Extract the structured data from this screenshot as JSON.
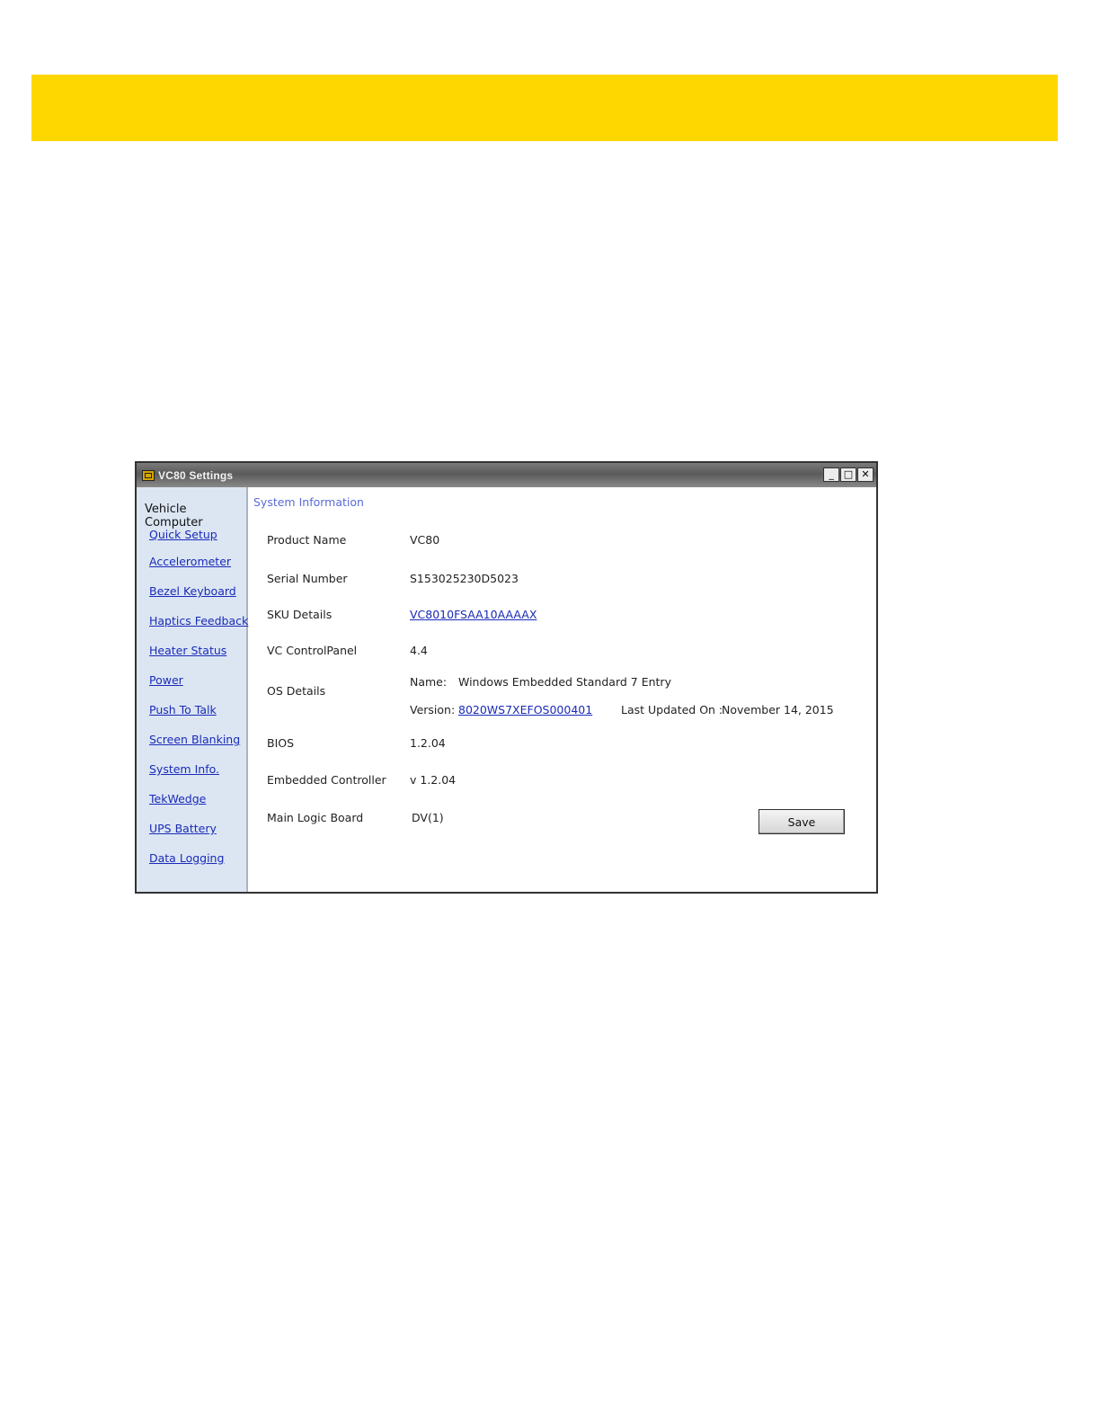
{
  "colors": {
    "banner": "#ffd700",
    "link": "#1a2bb8",
    "section_title": "#5a6bd6",
    "sidebar_bg": "#dce6f3"
  },
  "window": {
    "title": "VC80 Settings",
    "controls": {
      "minimize": "_",
      "maximize": "□",
      "close": "✕"
    }
  },
  "sidebar": {
    "header": "Vehicle Computer",
    "items": [
      {
        "label": "Quick Setup"
      },
      {
        "label": "Accelerometer"
      },
      {
        "label": "Bezel Keyboard"
      },
      {
        "label": "Haptics Feedback"
      },
      {
        "label": "Heater Status"
      },
      {
        "label": "Power"
      },
      {
        "label": "Push To Talk"
      },
      {
        "label": "Screen Blanking"
      },
      {
        "label": "System Info."
      },
      {
        "label": "TekWedge"
      },
      {
        "label": "UPS Battery"
      },
      {
        "label": "Data Logging"
      }
    ]
  },
  "main": {
    "section_title": "System Information",
    "product_name": {
      "label": "Product Name",
      "value": "VC80"
    },
    "serial_number": {
      "label": "Serial Number",
      "value": "S153025230D5023"
    },
    "sku_details": {
      "label": "SKU Details",
      "value": "VC8010FSAA10AAAAX"
    },
    "control_panel": {
      "label": "VC ControlPanel",
      "value": "4.4"
    },
    "os_details": {
      "label": "OS Details",
      "name_label": "Name:",
      "name_value": "Windows Embedded Standard 7 Entry",
      "version_label": "Version:",
      "version_value": "8020WS7XEFOS000401",
      "updated_label": "Last Updated On :",
      "updated_value": "November 14, 2015"
    },
    "bios": {
      "label": "BIOS",
      "value": "1.2.04"
    },
    "embedded_controller": {
      "label": "Embedded Controller",
      "value": "v 1.2.04"
    },
    "main_logic_board": {
      "label": "Main Logic Board",
      "value": "DV(1)"
    },
    "save_label": "Save"
  }
}
